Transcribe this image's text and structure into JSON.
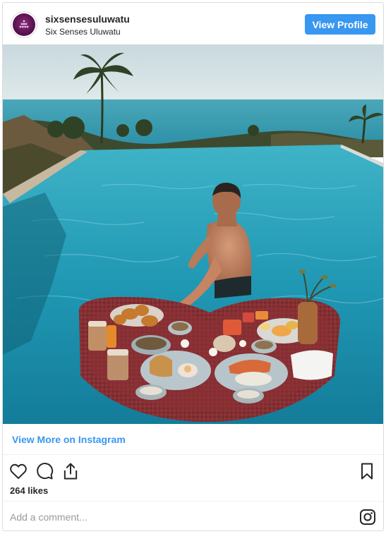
{
  "post": {
    "username": "sixsensesuluwatu",
    "location": "Six Senses Uluwatu",
    "view_profile_label": "View Profile",
    "view_more_label": "View More on Instagram",
    "likes_text": "264 likes",
    "comment_placeholder": "Add a comment..."
  },
  "icons": {
    "like": "heart-icon",
    "comment": "comment-icon",
    "share": "share-icon",
    "save": "bookmark-icon",
    "brand": "instagram-icon"
  },
  "colors": {
    "accent": "#3897f0",
    "text": "#262626",
    "border": "#dbdbdb",
    "avatar": "#5a1250"
  }
}
